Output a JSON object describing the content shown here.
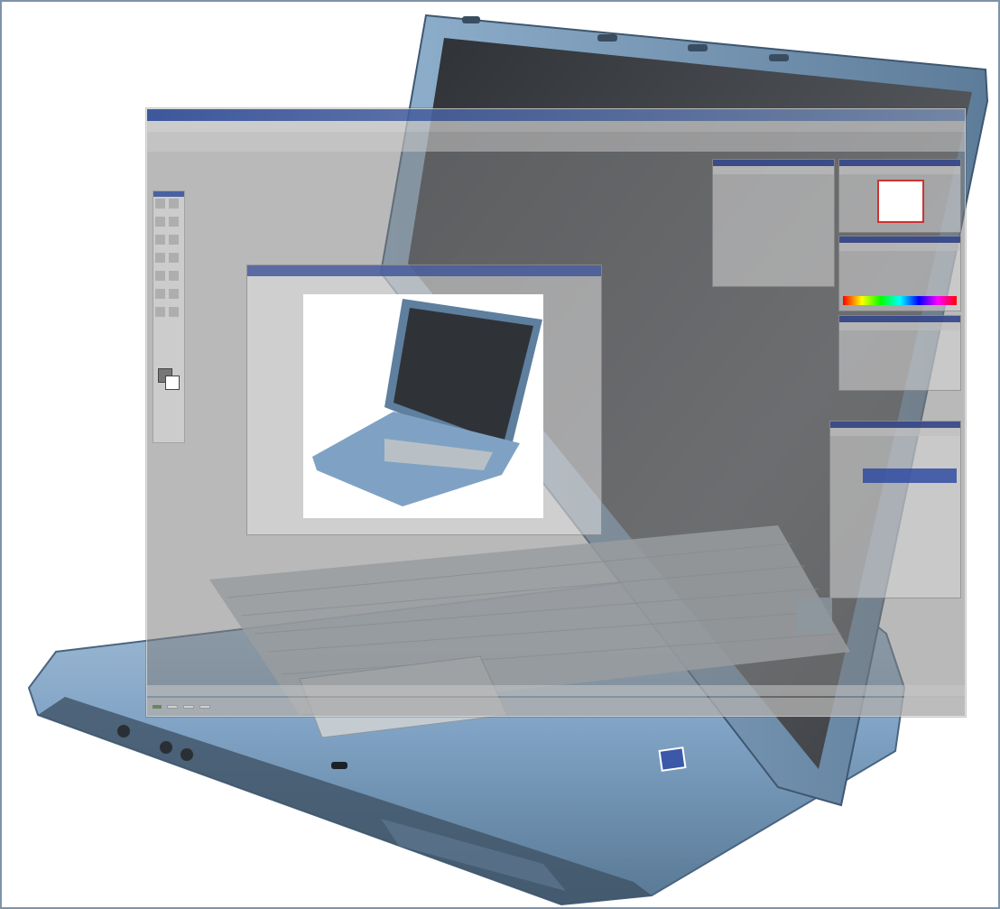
{
  "image": {
    "description_labels": {
      "laptop_label": "",
      "app_title": "",
      "doc_title": ""
    }
  },
  "colors": {
    "frame_border": "#7f93a8",
    "laptop_body": "#7fa2c4",
    "laptop_dark": "#3b4552",
    "screen": "#4a4d52",
    "keyboard": "#b8c0c6",
    "overlay_gray": "#808080",
    "titlebar_blue": "#2c4696"
  },
  "icons": {
    "photoshop_window": "app-window",
    "toolbox": "toolbox-icon",
    "foreground_color": "swatch-icon",
    "start_button": "start-icon",
    "intel_badge": "badge-icon"
  }
}
